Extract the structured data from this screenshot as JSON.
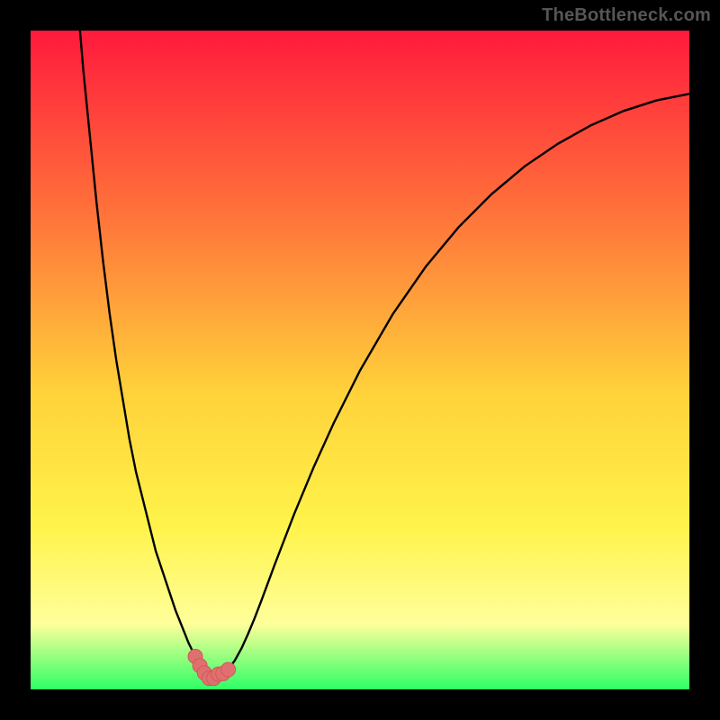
{
  "watermark": {
    "text": "TheBottleneck.com"
  },
  "colors": {
    "frame": "#000000",
    "gradient_top": "#ff1a3c",
    "gradient_mid1": "#ff7a3a",
    "gradient_mid2": "#ffd23a",
    "gradient_yellow": "#fff34a",
    "gradient_light": "#ffff9a",
    "gradient_bottom": "#2eff66",
    "curve": "#000000",
    "marker_fill": "#e07070",
    "marker_stroke": "#d05858"
  },
  "chart_data": {
    "type": "line",
    "title": "",
    "xlabel": "",
    "ylabel": "",
    "xlim": [
      0,
      100
    ],
    "ylim": [
      0,
      100
    ],
    "grid": false,
    "series": [
      {
        "name": "curve",
        "x": [
          7.5,
          8,
          9,
          10,
          11,
          12,
          13,
          14,
          15,
          16,
          17,
          18,
          19,
          20,
          21,
          22,
          23,
          24,
          25,
          26,
          27,
          27.5,
          28,
          29,
          30,
          31,
          32,
          33,
          34,
          35,
          37,
          40,
          43,
          46,
          50,
          55,
          60,
          65,
          70,
          75,
          80,
          85,
          90,
          95,
          100
        ],
        "y": [
          100,
          94,
          84,
          74,
          65,
          57,
          50,
          44,
          38,
          33,
          29,
          25,
          21,
          18,
          15,
          12,
          9.5,
          7,
          5,
          3.5,
          2.2,
          1.5,
          1.6,
          2,
          3,
          4.4,
          6.2,
          8.4,
          10.8,
          13.4,
          18.8,
          26.6,
          33.8,
          40.4,
          48.4,
          57,
          64.2,
          70.2,
          75.2,
          79.4,
          82.8,
          85.6,
          87.8,
          89.4,
          90.4
        ]
      }
    ],
    "markers_near_minimum": {
      "x": [
        25.0,
        25.7,
        26.4,
        27.1,
        27.8,
        28.5,
        29.2,
        30.0
      ],
      "y": [
        5.0,
        3.6,
        2.5,
        1.7,
        1.7,
        2.3,
        2.4,
        3.0
      ]
    },
    "minimum": {
      "x": 27.5,
      "y": 1.5
    }
  }
}
